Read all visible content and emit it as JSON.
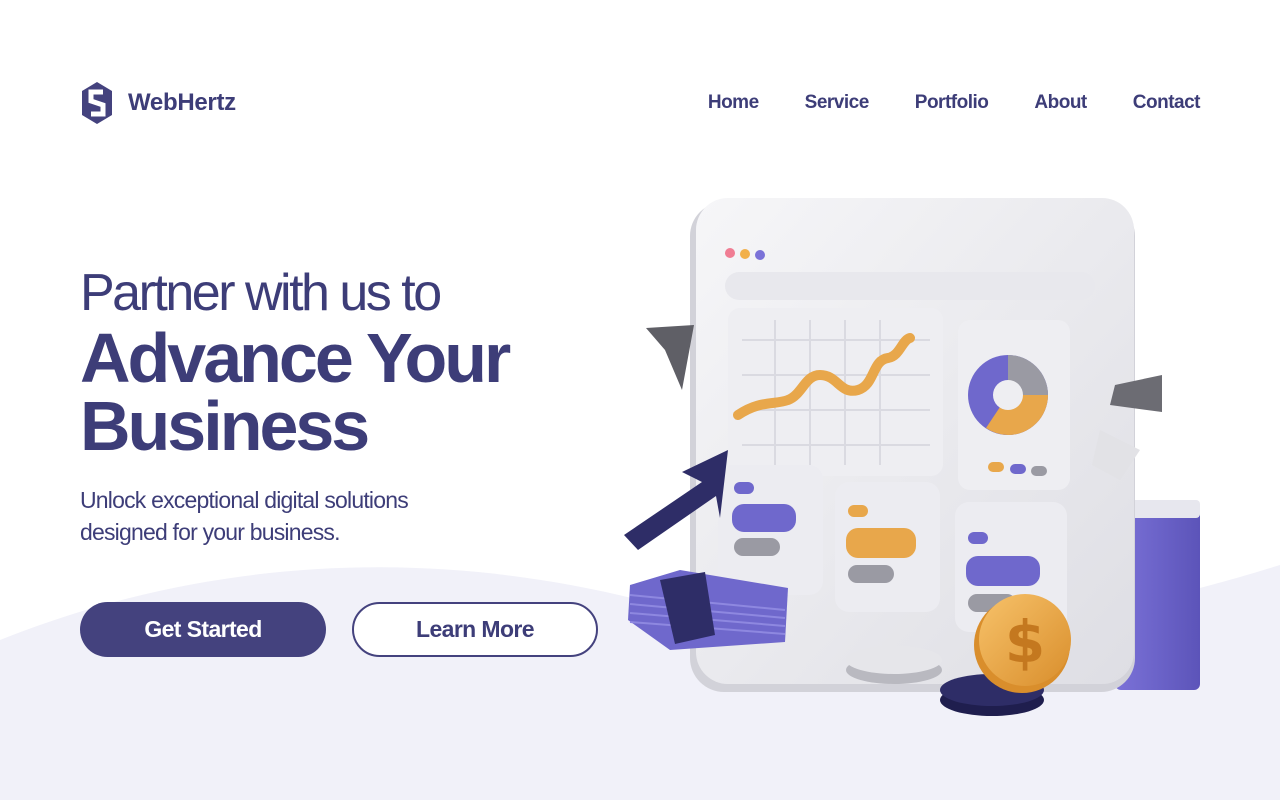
{
  "brand": {
    "name": "WebHertz",
    "logo_icon": "hexagon-s-logo-icon"
  },
  "nav": {
    "items": [
      {
        "label": "Home"
      },
      {
        "label": "Service"
      },
      {
        "label": "Portfolio"
      },
      {
        "label": "About"
      },
      {
        "label": "Contact"
      }
    ]
  },
  "hero": {
    "line1": "Partner with us to",
    "line2a": "Advance Your",
    "line2b": "Business",
    "subtitle1": "Unlock exceptional digital solutions",
    "subtitle2": "designed for your business."
  },
  "buttons": {
    "primary": "Get Started",
    "secondary": "Learn More"
  },
  "colors": {
    "primary": "#44427e",
    "text": "#3d3d78",
    "wave": "#f1f1f9",
    "accent_purple": "#6f68cc",
    "accent_orange": "#e8a74b"
  }
}
